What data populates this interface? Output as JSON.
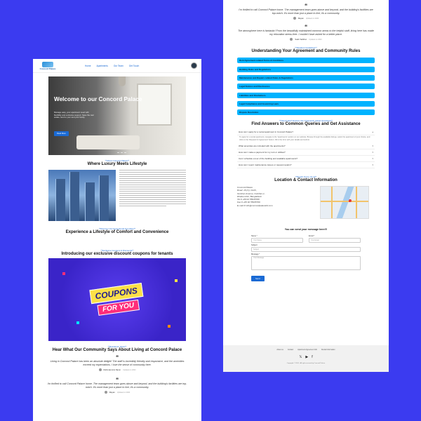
{
  "nav": {
    "logo_text": "Concord Palace",
    "links": [
      "Home",
      "Apartments",
      "Our Team",
      "Get Touch"
    ]
  },
  "hero": {
    "title": "Welcome to our Concord Palace",
    "subtitle": "Manage easy, your apartment need with flexibility and exclusive support. Save the real estate, tend to your and your family.",
    "button": "Read More"
  },
  "about": {
    "eyebrow": "**About Concord Palace**",
    "title": "Where Luxury Meets Lifestyle"
  },
  "amenities": {
    "eyebrow": "**Discover Our Exceptional Amenities**",
    "title": "Experience a Lifestyle of Comfort and Convenience"
  },
  "coupons": {
    "eyebrow": "**Exclusive Coupons & Discounts**",
    "title": "Introducing our exclusive discount coupons for tenants",
    "badge_line1": "COUPONS",
    "badge_line2": "FOR YOU"
  },
  "testimonials": {
    "eyebrow": "**Residents' Voice**",
    "title": "Hear What Our Community Says About Living at Concord Palace",
    "items": [
      {
        "text": "Living in Concord Palace has been an absolute delight! The staff is incredibly friendly and responsive, and the amenities exceed my expectations. I love the sense of community here.",
        "author": "Rahmatunnis Nipun",
        "date": "Updated on 2024"
      },
      {
        "text": "I'm thrilled to call Concord Palace home. The management team goes above and beyond, and the building's facilities are top-notch. It's more than just a place to live; it's a community.",
        "author": "Rayan",
        "date": "Updated on 2024"
      },
      {
        "text": "I'm thrilled to call Concord Palace home. The management team goes above and beyond, and the building's facilities are top-notch. It's more than just a place to live; it's a community.",
        "author": "Rayan",
        "date": "Updated on 2024"
      },
      {
        "text": "The atmosphere here is fantastic! From the beautifully maintained common areas to the helpful staff, living here has made my relocation stress-free. I couldn't have asked for a better place.",
        "author": "Sakir Sahibur",
        "date": "Updated on 2024"
      }
    ]
  },
  "rules": {
    "eyebrow": "**Resident Guidelines**",
    "title": "Understanding Your Agreement and Community Rules",
    "items": [
      "Rent Agreement-related Terms & Conditions",
      "Building Rules and Regulations",
      "Maintenance and Repairs related Rules & Regulations",
      "Legal Notices and Disclosures",
      "Liabilities and Disclaimers",
      "Legal Compliance and Governing Laws",
      "Dispute Resolution"
    ]
  },
  "faq": {
    "eyebrow": "**Need Help? Explore Our Frequently Asked Questions**",
    "title": "Find Answers to Common Queries and Get Assistance",
    "open_answer": "To apply for a rental apartment, navigate to the 'Apartments' section on our website. Browse through the available listings, select the apartment of your choice, and click on the 'Request for Agreement' button. Fill in the form with your details and submit.",
    "items": [
      "How can I apply for a rental apartment in Concord Palace?",
      "What amenities are included with the apartments?",
      "How can I make a payment for my rent or utilities?",
      "Can I schedule a tour of the building and available apartments?",
      "How can I report maintenance issues or request repairs?"
    ]
  },
  "contact": {
    "eyebrow": "**Reach Out to Us at**",
    "title": "Location & Contact Information",
    "lines": [
      "Concord Palace",
      "Road: 18 (C), North,",
      "Gulshan Avenue, Gulshan-1,",
      "Dhaka-1212, Bangladesh",
      "Tel # +88 02 55045708",
      "Fax # +88 02 55045709",
      "E-mail # info@concordpalacebd.com"
    ]
  },
  "form": {
    "title": "You can send your message here!!!",
    "name_label": "Name *",
    "name_placeholder": "Your Name",
    "email_label": "Email *",
    "email_placeholder": "Your Email",
    "subject_label": "Subject",
    "subject_placeholder": "Subject",
    "message_label": "Message *",
    "message_placeholder": "Your Message",
    "send": "Send"
  },
  "footer": {
    "links": [
      "About us",
      "Contact",
      "Apartment Agreement Info",
      "Rental Information"
    ],
    "copyright": "Copyright © 2024 - All right reserved by Concord Palace"
  }
}
